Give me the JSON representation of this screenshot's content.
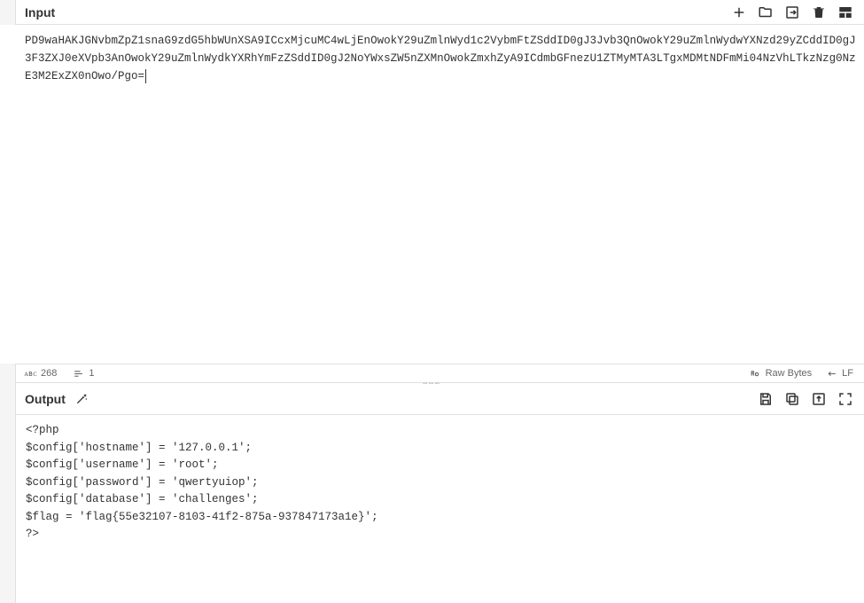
{
  "input": {
    "title": "Input",
    "content": "PD9waHAKJGNvbmZpZ1snaG9zdG5hbWUnXSA9ICcxMjcuMC4wLjEnOwokY29uZmlnWyd1c2VybmFtZSddID0gJ3Jvb3QnOwokY29uZmlnWydwYXNzd29yZCddID0gJ3F3ZXJ0eXVpb3AnOwokY29uZmlnWydkYXRhYmFzZSddID0gJ2NoYWxsZW5nZXMnOwokZmxhZyA9ICdmbGFnezU1ZTMyMTA3LTgxMDMtNDFmMi04NzVhLTkzNzg0NzE3M2ExZX0nOwo/Pgo="
  },
  "status": {
    "length_label": "268",
    "lines_label": "1",
    "raw_bytes": "Raw Bytes",
    "eol": "LF"
  },
  "output": {
    "title": "Output",
    "lines": [
      "<?php",
      "$config['hostname'] = '127.0.0.1';",
      "$config['username'] = 'root';",
      "$config['password'] = 'qwertyuiop';",
      "$config['database'] = 'challenges';",
      "$flag = 'flag{55e32107-8103-41f2-875a-937847173a1e}';",
      "?>"
    ]
  },
  "icons": {
    "abc": "ᴀʙᴄ",
    "lines": "="
  }
}
